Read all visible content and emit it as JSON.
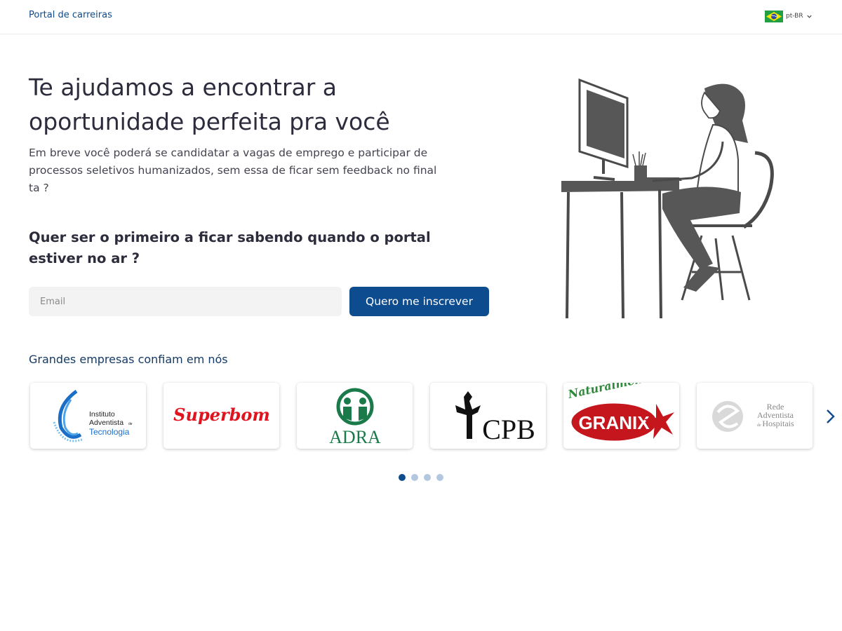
{
  "header": {
    "brand": "Portal de carreiras",
    "language": "pt-BR"
  },
  "hero": {
    "title": "Te ajudamos a encontrar a oportunidade perfeita pra você",
    "subtitle": "Em breve você poderá se candidatar a vagas de emprego e participar de processos seletivos humanizados, sem essa de ficar sem feedback no final ta ?",
    "cta_title": "Quer ser o primeiro a ficar sabendo quando o portal estiver no ar ?",
    "email_placeholder": "Email",
    "email_value": "",
    "subscribe_label": "Quero me inscrever"
  },
  "partners": {
    "title": "Grandes empresas confiam em nós",
    "logos": [
      {
        "name": "Instituto Adventista de Tecnologia",
        "line1": "Instituto",
        "line2": "Adventista",
        "line2_small": "de",
        "line3": "Tecnologia"
      },
      {
        "name": "Superbom",
        "text": "Superbom"
      },
      {
        "name": "ADRA",
        "text": "ADRA"
      },
      {
        "name": "CPB",
        "text": "CPB"
      },
      {
        "name": "Granix",
        "text": "GRANIX",
        "tagline": "Naturalmente"
      },
      {
        "name": "Rede Adventista de Hospitais",
        "line1": "Rede",
        "line2": "Adventista",
        "line3": "de",
        "line4": "Hospitais"
      }
    ],
    "pages": 4,
    "current_page": 1
  },
  "colors": {
    "primary": "#0d4c8f",
    "brand_text": "#0e4a8a",
    "input_bg": "#f3f3f4",
    "dot_inactive": "#b3c8de",
    "superbom_red": "#e0141e",
    "adra_green": "#1a7a4a",
    "granix_red": "#c4161c",
    "granix_green": "#2e8a3a"
  },
  "icons": {
    "language_flag": "brazil-flag-icon",
    "dropdown": "chevron-down-icon",
    "carousel_next": "chevron-right-icon"
  }
}
